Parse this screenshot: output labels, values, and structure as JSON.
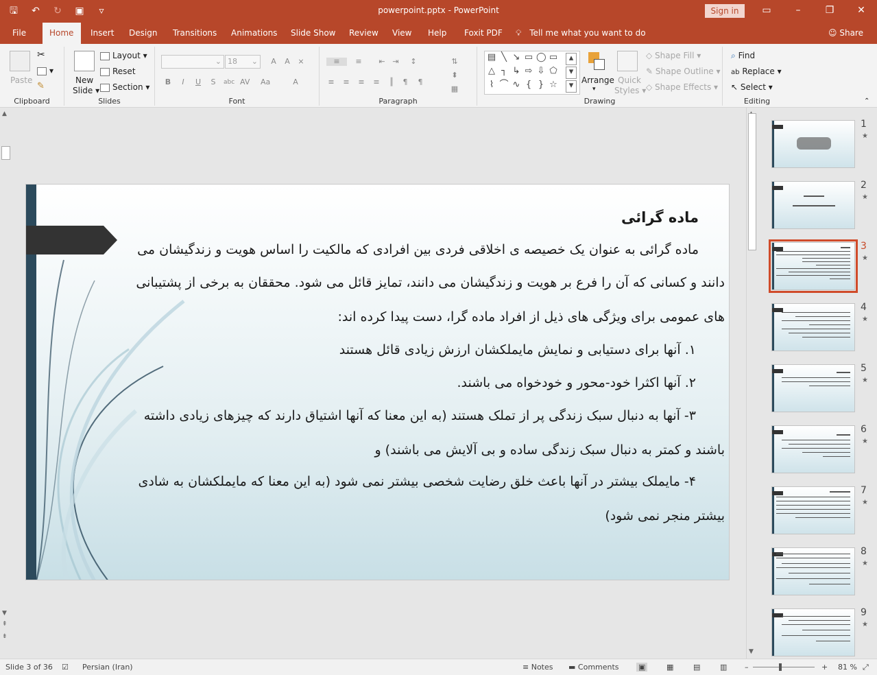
{
  "window": {
    "title": "powerpoint.pptx  -  PowerPoint",
    "sign_in": "Sign in"
  },
  "tabs": [
    {
      "label": "File"
    },
    {
      "label": "Home",
      "active": true
    },
    {
      "label": "Insert"
    },
    {
      "label": "Design"
    },
    {
      "label": "Transitions"
    },
    {
      "label": "Animations"
    },
    {
      "label": "Slide Show"
    },
    {
      "label": "Review"
    },
    {
      "label": "View"
    },
    {
      "label": "Help"
    },
    {
      "label": "Foxit PDF"
    }
  ],
  "tell_me": "Tell me what you want to do",
  "share": "Share",
  "ribbon": {
    "clipboard": {
      "label": "Clipboard",
      "paste": "Paste"
    },
    "slides": {
      "label": "Slides",
      "new_slide_1": "New",
      "new_slide_2": "Slide",
      "layout": "Layout",
      "reset": "Reset",
      "section": "Section"
    },
    "font": {
      "label": "Font",
      "font_size": "18"
    },
    "paragraph": {
      "label": "Paragraph"
    },
    "drawing": {
      "label": "Drawing",
      "arrange": "Arrange",
      "quick_styles_1": "Quick",
      "quick_styles_2": "Styles",
      "shape_fill": "Shape Fill",
      "shape_outline": "Shape Outline",
      "shape_effects": "Shape Effects"
    },
    "editing": {
      "label": "Editing",
      "find": "Find",
      "replace": "Replace",
      "select": "Select"
    }
  },
  "slide": {
    "title": "ماده گرائی",
    "lines": [
      "ماده گرائی به عنوان یک خصیصه ی اخلاقی فردی بین افرادی که مالکیت را اساس هویت و زندگیشان می",
      "دانند و کسانی که آن را فرع بر هویت و زندگیشان می دانند، تمایز قائل می شود. محققان به برخی از پشتیبانی",
      "های عمومی برای ویژگی های ذیل از افراد ماده گرا، دست پیدا کرده اند:",
      "١. آنها برای دستیابی و نمایش مایملکشان ارزش زیادی قائل هستند",
      "٢. آنها اکثرا خود-محور و خودخواه می باشند.",
      "٣- آنها به دنبال سبک زندگی پر از تملک هستند (به این معنا که آنها اشتیاق دارند که چیزهای زیادی داشته",
      "باشند و کمتر به دنبال سبک زندگی ساده و بی آلایش می باشند) و",
      "۴- مایملک بیشتر در آنها باعث خلق رضایت شخصی بیشتر نمی شود (به این معنا که مایملکشان به شادی",
      "بیشتر منجر نمی شود)"
    ]
  },
  "thumbnails": [
    {
      "num": "1",
      "title": "ماده گرائی"
    },
    {
      "num": "2",
      "title": "موضوع:"
    },
    {
      "num": "3",
      "selected": true
    },
    {
      "num": "4"
    },
    {
      "num": "5"
    },
    {
      "num": "6"
    },
    {
      "num": "7"
    },
    {
      "num": "8"
    },
    {
      "num": "9"
    }
  ],
  "status": {
    "slide_of": "Slide 3 of 36",
    "language": "Persian (Iran)",
    "notes": "Notes",
    "comments": "Comments",
    "zoom": "81 %"
  },
  "colors": {
    "accent": "#b7472a",
    "slide_sidebar": "#2c4a5c"
  }
}
